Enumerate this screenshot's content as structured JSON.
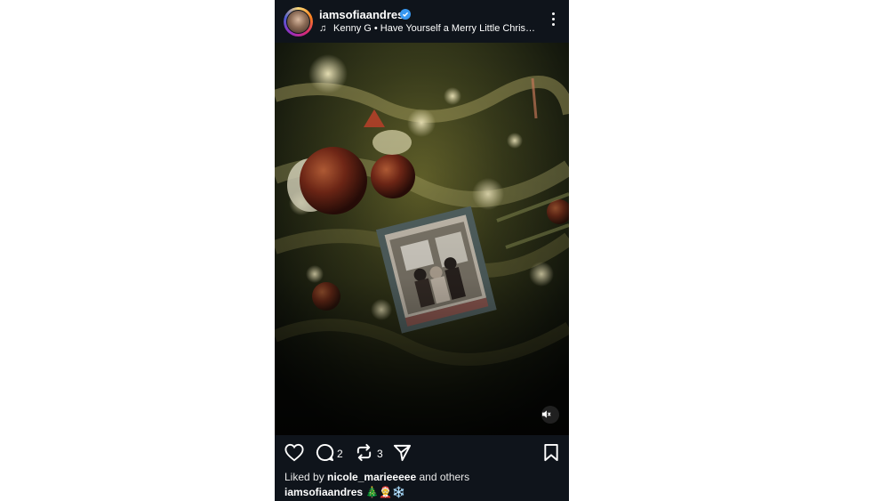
{
  "post": {
    "username": "iamsofiaandres",
    "verified": true,
    "music": {
      "artist": "Kenny G",
      "separator": "•",
      "title": "Have Yourself a Merry Little Christ…"
    },
    "media": {
      "description_icon": "photo-icon",
      "muted": true
    },
    "actions": {
      "comment_count": "2",
      "repost_count": "3"
    },
    "liked_by": {
      "prefix": "Liked by",
      "user": "nicole_marieeeee",
      "suffix": "and others"
    },
    "caption": {
      "username": "iamsofiaandres",
      "text": "🎄🤶❄️"
    }
  },
  "colors": {
    "background": "#0f141b",
    "verified_blue": "#3897f0",
    "text": "#ffffff"
  }
}
